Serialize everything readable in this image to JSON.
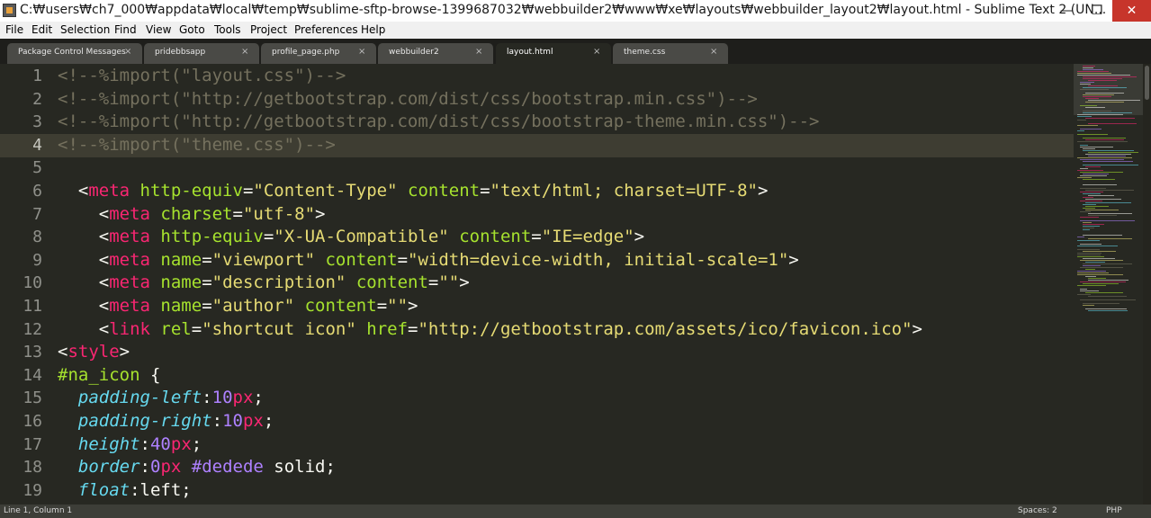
{
  "window": {
    "title": "C:₩users₩ch7_000₩appdata₩local₩temp₩sublime-sftp-browse-1399687032₩webbuilder2₩www₩xe₩layouts₩webbuilder_layout2₩layout.html - Sublime Text 2 (UN...",
    "min_glyph": "—",
    "max_glyph": "❐",
    "close_glyph": "✕"
  },
  "menu": [
    "File",
    "Edit",
    "Selection",
    "Find",
    "View",
    "Goto",
    "Tools",
    "Project",
    "Preferences",
    "Help"
  ],
  "tabs": [
    {
      "label": "Package Control Messages",
      "active": false
    },
    {
      "label": "pridebbsapp",
      "active": false
    },
    {
      "label": "profile_page.php",
      "active": false
    },
    {
      "label": "webbuilder2",
      "active": false
    },
    {
      "label": "layout.html",
      "active": true
    },
    {
      "label": "theme.css",
      "active": false
    }
  ],
  "tab_close_glyph": "×",
  "editor": {
    "current_line": 4,
    "lines": [
      {
        "n": "1",
        "tokens": [
          [
            "cm",
            "<!--%import(\"layout.css\")-->"
          ]
        ]
      },
      {
        "n": "2",
        "tokens": [
          [
            "cm",
            "<!--%import(\"http://getbootstrap.com/dist/css/bootstrap.min.css\")-->"
          ]
        ]
      },
      {
        "n": "3",
        "tokens": [
          [
            "cm",
            "<!--%import(\"http://getbootstrap.com/dist/css/bootstrap-theme.min.css\")-->"
          ]
        ]
      },
      {
        "n": "4",
        "tokens": [
          [
            "cm",
            "<!--%import(\"theme.css\")-->"
          ]
        ]
      },
      {
        "n": "5",
        "tokens": []
      },
      {
        "n": "6",
        "tokens": [
          [
            "pl",
            "  <"
          ],
          [
            "tg",
            "meta"
          ],
          [
            "pl",
            " "
          ],
          [
            "at",
            "http-equiv"
          ],
          [
            "pl",
            "="
          ],
          [
            "st",
            "\"Content-Type\""
          ],
          [
            "pl",
            " "
          ],
          [
            "at",
            "content"
          ],
          [
            "pl",
            "="
          ],
          [
            "st",
            "\"text/html; charset=UTF-8\""
          ],
          [
            "pl",
            ">"
          ]
        ]
      },
      {
        "n": "7",
        "tokens": [
          [
            "pl",
            "    <"
          ],
          [
            "tg",
            "meta"
          ],
          [
            "pl",
            " "
          ],
          [
            "at",
            "charset"
          ],
          [
            "pl",
            "="
          ],
          [
            "st",
            "\"utf-8\""
          ],
          [
            "pl",
            ">"
          ]
        ]
      },
      {
        "n": "8",
        "tokens": [
          [
            "pl",
            "    <"
          ],
          [
            "tg",
            "meta"
          ],
          [
            "pl",
            " "
          ],
          [
            "at",
            "http-equiv"
          ],
          [
            "pl",
            "="
          ],
          [
            "st",
            "\"X-UA-Compatible\""
          ],
          [
            "pl",
            " "
          ],
          [
            "at",
            "content"
          ],
          [
            "pl",
            "="
          ],
          [
            "st",
            "\"IE=edge\""
          ],
          [
            "pl",
            ">"
          ]
        ]
      },
      {
        "n": "9",
        "tokens": [
          [
            "pl",
            "    <"
          ],
          [
            "tg",
            "meta"
          ],
          [
            "pl",
            " "
          ],
          [
            "at",
            "name"
          ],
          [
            "pl",
            "="
          ],
          [
            "st",
            "\"viewport\""
          ],
          [
            "pl",
            " "
          ],
          [
            "at",
            "content"
          ],
          [
            "pl",
            "="
          ],
          [
            "st",
            "\"width=device-width, initial-scale=1\""
          ],
          [
            "pl",
            ">"
          ]
        ]
      },
      {
        "n": "10",
        "tokens": [
          [
            "pl",
            "    <"
          ],
          [
            "tg",
            "meta"
          ],
          [
            "pl",
            " "
          ],
          [
            "at",
            "name"
          ],
          [
            "pl",
            "="
          ],
          [
            "st",
            "\"description\""
          ],
          [
            "pl",
            " "
          ],
          [
            "at",
            "content"
          ],
          [
            "pl",
            "="
          ],
          [
            "st",
            "\"\""
          ],
          [
            "pl",
            ">"
          ]
        ]
      },
      {
        "n": "11",
        "tokens": [
          [
            "pl",
            "    <"
          ],
          [
            "tg",
            "meta"
          ],
          [
            "pl",
            " "
          ],
          [
            "at",
            "name"
          ],
          [
            "pl",
            "="
          ],
          [
            "st",
            "\"author\""
          ],
          [
            "pl",
            " "
          ],
          [
            "at",
            "content"
          ],
          [
            "pl",
            "="
          ],
          [
            "st",
            "\"\""
          ],
          [
            "pl",
            ">"
          ]
        ]
      },
      {
        "n": "12",
        "tokens": [
          [
            "pl",
            "    <"
          ],
          [
            "tg",
            "link"
          ],
          [
            "pl",
            " "
          ],
          [
            "at",
            "rel"
          ],
          [
            "pl",
            "="
          ],
          [
            "st",
            "\"shortcut icon\""
          ],
          [
            "pl",
            " "
          ],
          [
            "at",
            "href"
          ],
          [
            "pl",
            "="
          ],
          [
            "st",
            "\"http://getbootstrap.com/assets/ico/favicon.ico\""
          ],
          [
            "pl",
            ">"
          ]
        ]
      },
      {
        "n": "13",
        "tokens": [
          [
            "pl",
            "<"
          ],
          [
            "tg",
            "style"
          ],
          [
            "pl",
            ">"
          ]
        ]
      },
      {
        "n": "14",
        "tokens": [
          [
            "sl",
            "#na_icon"
          ],
          [
            "pl",
            " {"
          ]
        ]
      },
      {
        "n": "15",
        "tokens": [
          [
            "pl",
            "  "
          ],
          [
            "pr",
            "padding-left"
          ],
          [
            "pl",
            ":"
          ],
          [
            "nm",
            "10"
          ],
          [
            "ui",
            "px"
          ],
          [
            "pl",
            ";"
          ]
        ]
      },
      {
        "n": "16",
        "tokens": [
          [
            "pl",
            "  "
          ],
          [
            "pr",
            "padding-right"
          ],
          [
            "pl",
            ":"
          ],
          [
            "nm",
            "10"
          ],
          [
            "ui",
            "px"
          ],
          [
            "pl",
            ";"
          ]
        ]
      },
      {
        "n": "17",
        "tokens": [
          [
            "pl",
            "  "
          ],
          [
            "pr",
            "height"
          ],
          [
            "pl",
            ":"
          ],
          [
            "nm",
            "40"
          ],
          [
            "ui",
            "px"
          ],
          [
            "pl",
            ";"
          ]
        ]
      },
      {
        "n": "18",
        "tokens": [
          [
            "pl",
            "  "
          ],
          [
            "pr",
            "border"
          ],
          [
            "pl",
            ":"
          ],
          [
            "nm",
            "0"
          ],
          [
            "ui",
            "px"
          ],
          [
            "pl",
            " "
          ],
          [
            "nm",
            "#dedede"
          ],
          [
            "pl",
            " solid;"
          ]
        ]
      },
      {
        "n": "19",
        "tokens": [
          [
            "pl",
            "  "
          ],
          [
            "pr",
            "float"
          ],
          [
            "pl",
            ":left;"
          ]
        ]
      }
    ]
  },
  "status": {
    "position": "Line 1, Column 1",
    "spaces": "Spaces: 2",
    "syntax": "PHP"
  },
  "colors": {
    "editor_bg": "#272822",
    "comment": "#75715e",
    "tag": "#f92672",
    "attribute": "#a6e22e",
    "string": "#e6db74",
    "property": "#66d9ef",
    "number": "#ae81ff",
    "close_button": "#c7352b"
  }
}
